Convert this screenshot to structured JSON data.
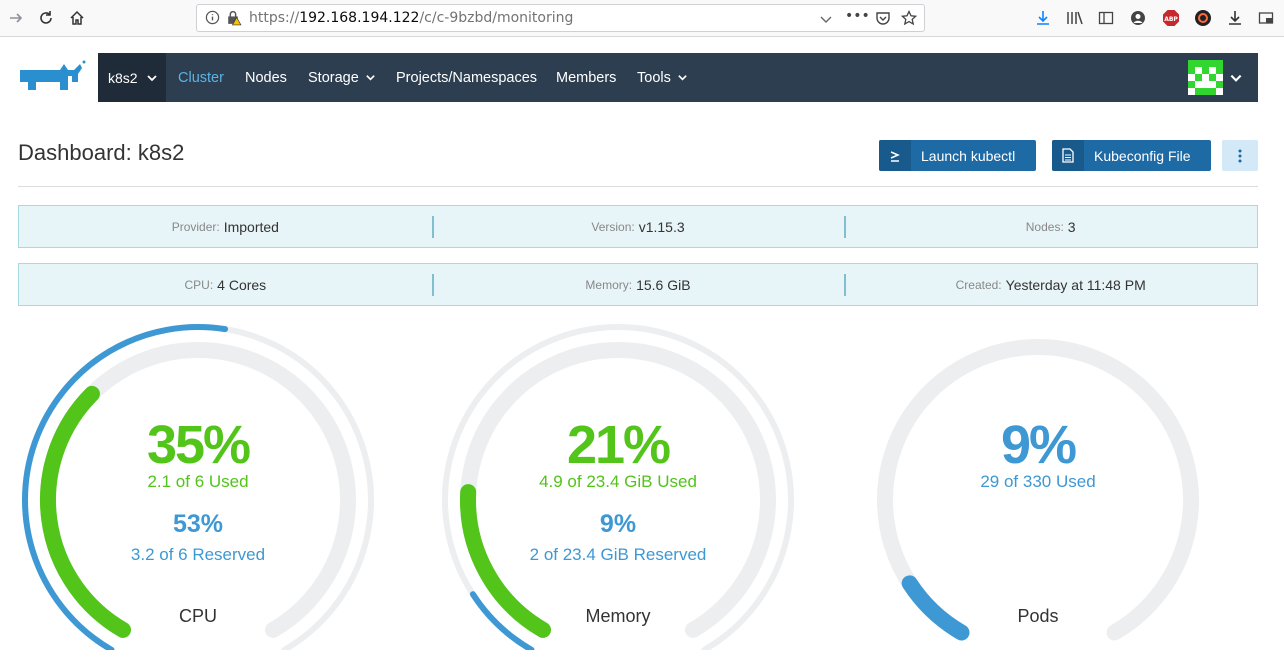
{
  "browser": {
    "url_prefix": "https://",
    "url_host": "192.168.194.122",
    "url_path": "/c/c-9bzbd/monitoring",
    "ellipsis": "•••"
  },
  "header": {
    "cluster_name": "k8s2",
    "nav": [
      {
        "label": "Cluster",
        "active": true,
        "dropdown": false
      },
      {
        "label": "Nodes",
        "active": false,
        "dropdown": false
      },
      {
        "label": "Storage",
        "active": false,
        "dropdown": true
      },
      {
        "label": "Projects/Namespaces",
        "active": false,
        "dropdown": false
      },
      {
        "label": "Members",
        "active": false,
        "dropdown": false
      },
      {
        "label": "Tools",
        "active": false,
        "dropdown": true
      }
    ],
    "nav_color": "#2c3e50",
    "active_color": "#5ab3e6"
  },
  "page": {
    "title": "Dashboard: k8s2",
    "launch_kubectl_label": "Launch kubectl",
    "kubeconfig_label": "Kubeconfig File"
  },
  "info_row_1": [
    {
      "label": "Provider:",
      "value": "Imported"
    },
    {
      "label": "Version:",
      "value": "v1.15.3"
    },
    {
      "label": "Nodes:",
      "value": "3"
    }
  ],
  "info_row_2": [
    {
      "label": "CPU:",
      "value": "4 Cores"
    },
    {
      "label": "Memory:",
      "value": "15.6 GiB"
    },
    {
      "label": "Created:",
      "value": "Yesterday at 11:48 PM"
    }
  ],
  "gauges": {
    "cpu": {
      "name": "CPU",
      "used_pct_label": "35%",
      "used_fraction": 0.35,
      "used_text": "2.1 of 6 Used",
      "reserved_pct_label": "53%",
      "reserved_fraction": 0.53,
      "reserved_text": "3.2 of 6 Reserved"
    },
    "memory": {
      "name": "Memory",
      "used_pct_label": "21%",
      "used_fraction": 0.21,
      "used_text": "4.9 of 23.4 GiB Used",
      "reserved_pct_label": "9%",
      "reserved_fraction": 0.09,
      "reserved_text": "2 of 23.4 GiB Reserved"
    },
    "pods": {
      "name": "Pods",
      "used_pct_label": "9%",
      "used_fraction": 0.09,
      "used_text": "29 of 330 Used"
    }
  },
  "colors": {
    "used": "#52c41a",
    "reserved": "#3d98d3",
    "track": "#eceef0",
    "pods": "#3d98d3"
  }
}
